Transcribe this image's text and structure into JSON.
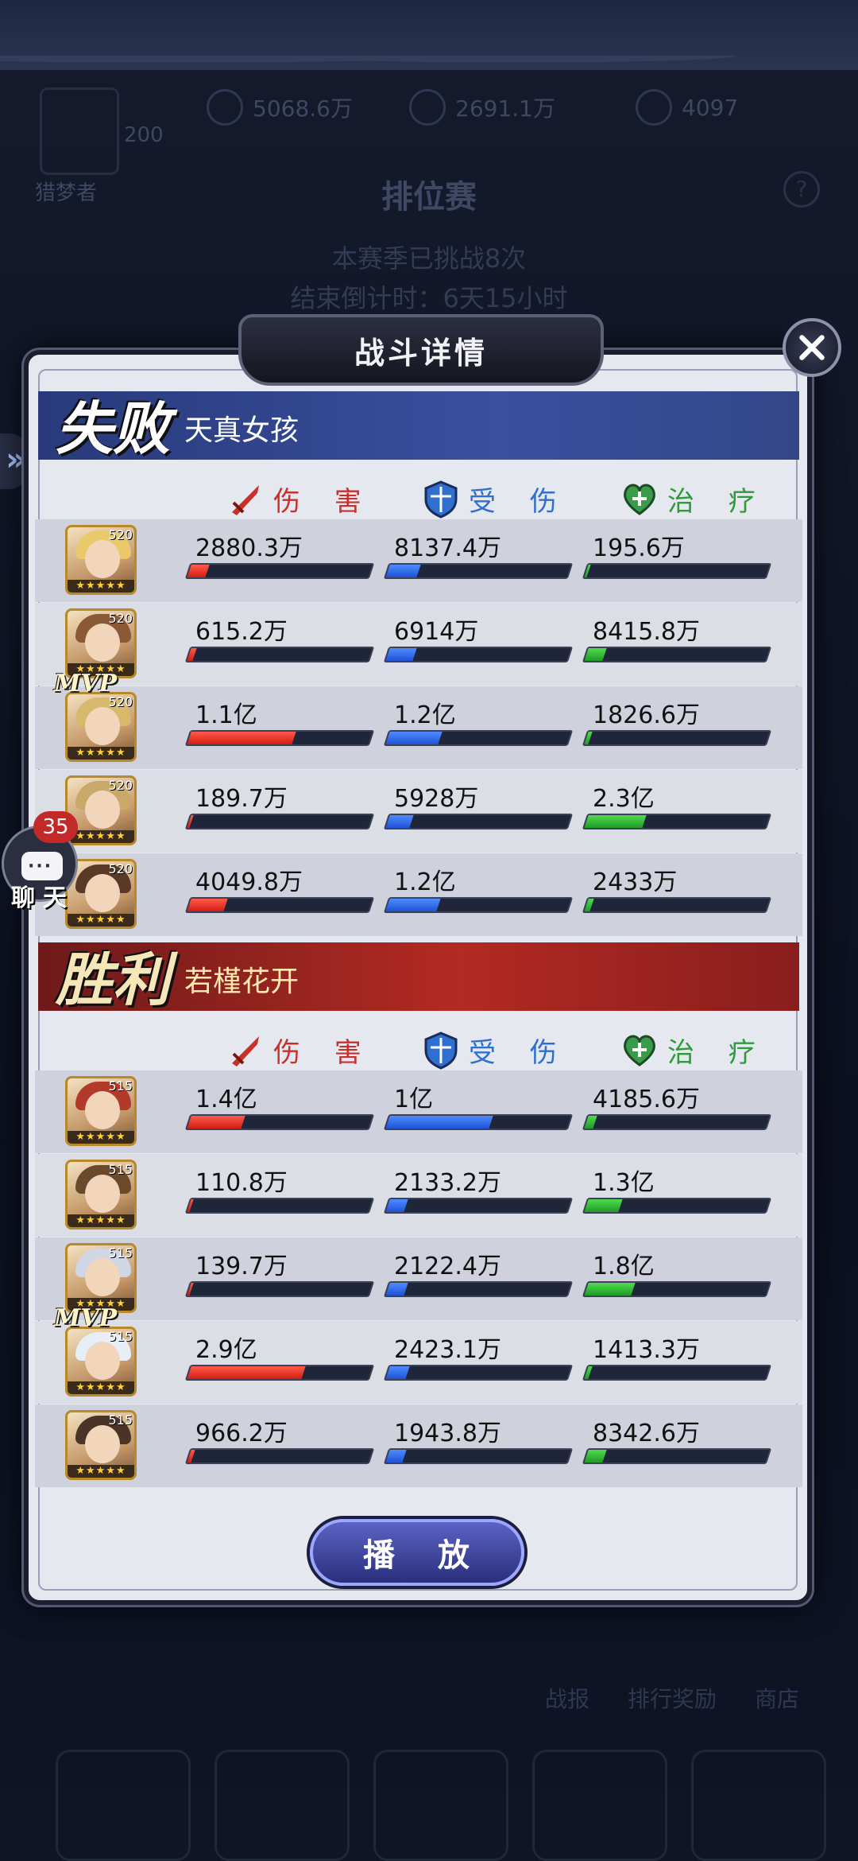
{
  "background": {
    "resources": [
      "5068.6万",
      "2691.1万",
      "4097"
    ],
    "player_level": "200",
    "player_name": "猎梦者",
    "mode_title": "排位赛",
    "season_status": "本赛季已挑战8次",
    "countdown": "结束倒计时：6天15小时",
    "bottom_labels": [
      "战报",
      "排行奖励",
      "商店"
    ]
  },
  "dialog": {
    "title": "战斗详情",
    "play_label": "播 放"
  },
  "columns": {
    "damage": "伤 害",
    "taken": "受 伤",
    "heal": "治 疗"
  },
  "chat": {
    "count": "35",
    "label": "聊天"
  },
  "teams": [
    {
      "result": "失败",
      "name": "天真女孩",
      "players": [
        {
          "level": "520",
          "mvp": false,
          "damage": "2880.3万",
          "taken": "8137.4万",
          "heal": "195.6万",
          "damage_ratio": 0.1,
          "taken_ratio": 0.17,
          "heal_ratio": 0.0
        },
        {
          "level": "520",
          "mvp": false,
          "damage": "615.2万",
          "taken": "6914万",
          "heal": "8415.8万",
          "damage_ratio": 0.03,
          "taken_ratio": 0.15,
          "heal_ratio": 0.1
        },
        {
          "level": "520",
          "mvp": true,
          "damage": "1.1亿",
          "taken": "1.2亿",
          "heal": "1826.6万",
          "damage_ratio": 0.58,
          "taken_ratio": 0.29,
          "heal_ratio": 0.02
        },
        {
          "level": "520",
          "mvp": false,
          "damage": "189.7万",
          "taken": "5928万",
          "heal": "2.3亿",
          "damage_ratio": 0.0,
          "taken_ratio": 0.13,
          "heal_ratio": 0.32
        },
        {
          "level": "520",
          "mvp": false,
          "damage": "4049.8万",
          "taken": "1.2亿",
          "heal": "2433万",
          "damage_ratio": 0.2,
          "taken_ratio": 0.28,
          "heal_ratio": 0.03
        }
      ]
    },
    {
      "result": "胜利",
      "name": "若槿花开",
      "players": [
        {
          "level": "515",
          "mvp": false,
          "damage": "1.4亿",
          "taken": "1亿",
          "heal": "4185.6万",
          "damage_ratio": 0.3,
          "taken_ratio": 0.57,
          "heal_ratio": 0.05
        },
        {
          "level": "515",
          "mvp": false,
          "damage": "110.8万",
          "taken": "2133.2万",
          "heal": "1.3亿",
          "damage_ratio": 0.0,
          "taken_ratio": 0.1,
          "heal_ratio": 0.19
        },
        {
          "level": "515",
          "mvp": false,
          "damage": "139.7万",
          "taken": "2122.4万",
          "heal": "1.8亿",
          "damage_ratio": 0.0,
          "taken_ratio": 0.1,
          "heal_ratio": 0.26
        },
        {
          "level": "515",
          "mvp": true,
          "damage": "2.9亿",
          "taken": "2423.1万",
          "heal": "1413.3万",
          "damage_ratio": 0.63,
          "taken_ratio": 0.11,
          "heal_ratio": 0.02
        },
        {
          "level": "515",
          "mvp": false,
          "damage": "966.2万",
          "taken": "1943.8万",
          "heal": "8342.6万",
          "damage_ratio": 0.02,
          "taken_ratio": 0.09,
          "heal_ratio": 0.1
        }
      ]
    }
  ],
  "colors": {
    "damage": "#d11d12",
    "taken": "#1f52d6",
    "heal": "#1f9a25",
    "lose_banner": "#3a4fa0",
    "win_banner": "#b22a22"
  }
}
